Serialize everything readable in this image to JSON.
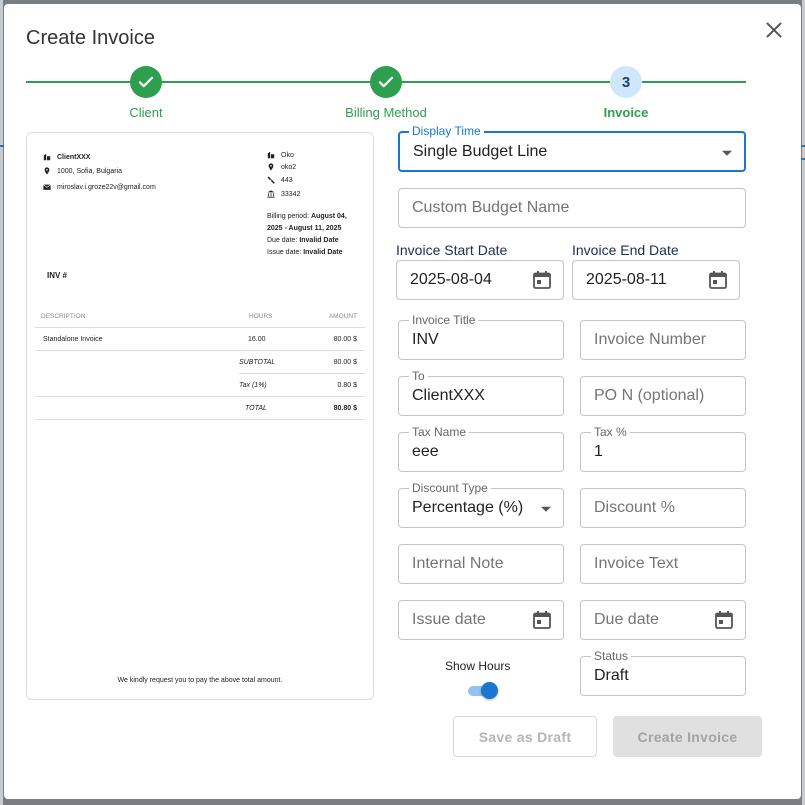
{
  "dialog": {
    "title": "Create Invoice"
  },
  "stepper": {
    "steps": [
      {
        "label": "Client",
        "status": "done"
      },
      {
        "label": "Billing Method",
        "status": "done"
      },
      {
        "label": "Invoice",
        "status": "current",
        "number": "3"
      }
    ],
    "color_done": "#2e9e4f"
  },
  "preview": {
    "client_name": "ClientXXX",
    "client_address": "1000, Sofia, Bulgaria",
    "client_email": "miroslav.i.groze22v@gmail.com",
    "company_name": "Oko",
    "company_line2": "oko2",
    "company_line3": "443",
    "company_line4": "33342",
    "billing_period_label": "Billing period:",
    "billing_period_value1": "August 04,",
    "billing_period_value2": "2025 - August 11, 2025",
    "due_label": "Due date:",
    "due_value": "Invalid Date",
    "issue_label": "Issue date:",
    "issue_value": "Invalid Date",
    "inv_number": "INV #",
    "table": {
      "headers": {
        "description": "DESCRIPTION",
        "hours": "HOURS",
        "amount": "AMOUNT"
      },
      "item": {
        "description": "Standalone Invoice",
        "hours": "16.00",
        "amount": "80.00 $"
      },
      "subtotal": {
        "label": "SUBTOTAL",
        "amount": "80.00 $"
      },
      "tax": {
        "label": "Tax (1%)",
        "amount": "0.80 $"
      },
      "total": {
        "label": "TOTAL",
        "amount": "80.80 $"
      }
    },
    "footer": "We kindly request you to pay the above total amount."
  },
  "form": {
    "display_time": {
      "label": "Display Time",
      "value": "Single Budget Line"
    },
    "custom_budget_name": {
      "placeholder": "Custom Budget Name"
    },
    "start_date": {
      "label": "Invoice Start Date",
      "value": "2025-08-04"
    },
    "end_date": {
      "label": "Invoice End Date",
      "value": "2025-08-11"
    },
    "invoice_title": {
      "label": "Invoice Title",
      "value": "INV"
    },
    "invoice_number": {
      "placeholder": "Invoice Number"
    },
    "to": {
      "label": "To",
      "value": "ClientXXX"
    },
    "po_number": {
      "placeholder": "PO N (optional)"
    },
    "tax_name": {
      "label": "Tax Name",
      "value": "eee"
    },
    "tax_percent": {
      "label": "Tax %",
      "value": "1"
    },
    "discount_type": {
      "label": "Discount Type",
      "value": "Percentage (%)"
    },
    "discount_percent": {
      "placeholder": "Discount %"
    },
    "internal_note": {
      "placeholder": "Internal Note"
    },
    "invoice_text": {
      "placeholder": "Invoice Text"
    },
    "issue_date": {
      "placeholder": "Issue date"
    },
    "due_date": {
      "placeholder": "Due date"
    },
    "show_hours": {
      "label": "Show Hours",
      "on": true
    },
    "status": {
      "label": "Status",
      "value": "Draft"
    }
  },
  "actions": {
    "save_draft": "Save as Draft",
    "create": "Create Invoice"
  },
  "colors": {
    "accent": "#1976d2",
    "success": "#2e9e4f",
    "disabled_text": "#a3a3a3"
  }
}
